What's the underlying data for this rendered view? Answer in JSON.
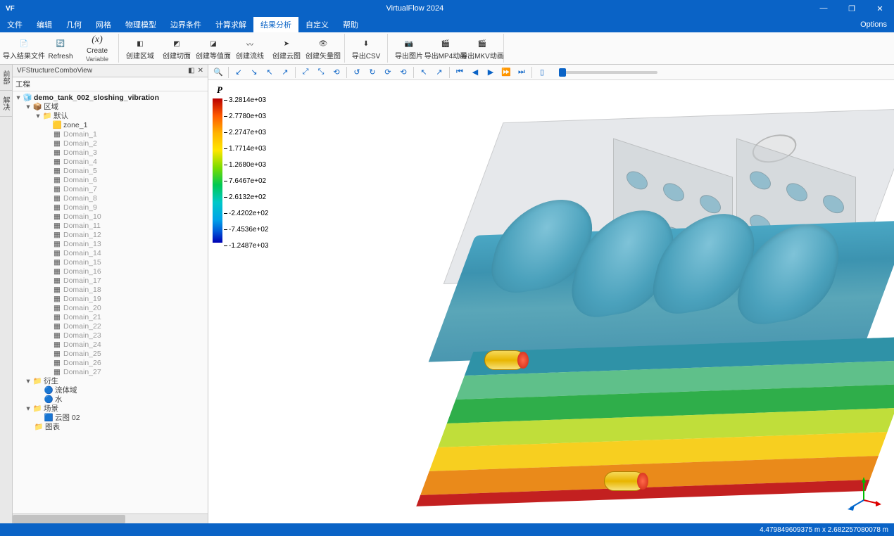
{
  "app": {
    "title": "VirtualFlow  2024",
    "logo": "VF"
  },
  "window_buttons": {
    "min": "—",
    "max": "❐",
    "close": "✕"
  },
  "menu": {
    "items": [
      "文件",
      "编辑",
      "几何",
      "网格",
      "物理模型",
      "边界条件",
      "计算求解",
      "结果分析",
      "自定义",
      "帮助"
    ],
    "active_index": 7,
    "right": "Options"
  },
  "ribbon": [
    {
      "icon": "import-icon",
      "label": "导入结果文件",
      "glyph": "📄"
    },
    {
      "icon": "refresh-icon",
      "label": "Refresh",
      "glyph": "🔄"
    },
    {
      "icon": "variable-icon",
      "label": "Create",
      "label2": "Variable",
      "glyph": "(x)"
    },
    {
      "icon": "region-icon",
      "label": "创建区域",
      "glyph": "◧"
    },
    {
      "icon": "slice-icon",
      "label": "创建切面",
      "glyph": "◩"
    },
    {
      "icon": "iso-icon",
      "label": "创建等值面",
      "glyph": "◪"
    },
    {
      "icon": "streamline-icon",
      "label": "创建流线",
      "glyph": "〰"
    },
    {
      "icon": "contour-icon",
      "label": "创建云图",
      "glyph": "➤"
    },
    {
      "icon": "vector-icon",
      "label": "创建矢量图",
      "glyph": "👁"
    },
    {
      "icon": "csv-icon",
      "label": "导出CSV",
      "glyph": "⬇"
    },
    {
      "icon": "image-icon",
      "label": "导出图片",
      "glyph": "📷"
    },
    {
      "icon": "mp4-icon",
      "label": "导出MP4动画",
      "glyph": "🎬"
    },
    {
      "icon": "mkv-icon",
      "label": "导出MKV动画",
      "glyph": "🎬"
    }
  ],
  "sidebar_tabs": [
    "前部",
    "解决"
  ],
  "tree_panel": {
    "title": "VFStructureComboView",
    "root": "工程",
    "project": "demo_tank_002_sloshing_vibration",
    "region": "区域",
    "default": "默认",
    "zone": "zone_1",
    "domains": [
      "Domain_1",
      "Domain_2",
      "Domain_3",
      "Domain_4",
      "Domain_5",
      "Domain_6",
      "Domain_7",
      "Domain_8",
      "Domain_9",
      "Domain_10",
      "Domain_11",
      "Domain_12",
      "Domain_13",
      "Domain_14",
      "Domain_15",
      "Domain_16",
      "Domain_17",
      "Domain_18",
      "Domain_19",
      "Domain_20",
      "Domain_21",
      "Domain_22",
      "Domain_23",
      "Domain_24",
      "Domain_25",
      "Domain_26",
      "Domain_27"
    ],
    "derived": "衍生",
    "derived_items": [
      "流体域",
      "水"
    ],
    "scene": "场景",
    "scene_items": [
      "云图 02"
    ],
    "chart": "图表"
  },
  "legend": {
    "title": "P",
    "ticks": [
      "3.2814e+03",
      "2.7780e+03",
      "2.2747e+03",
      "1.7714e+03",
      "1.2680e+03",
      "7.6467e+02",
      "2.6132e+02",
      "-2.4202e+02",
      "-7.4536e+02",
      "-1.2487e+03"
    ]
  },
  "playback": {
    "first": "⏮",
    "prev": "◀",
    "play": "▶",
    "next": "⏩",
    "last": "⏭"
  },
  "status": {
    "coords": "4.479849609375 m x 2.682257080078 m"
  },
  "strata_colors": [
    "#2f92a7",
    "#5fc08a",
    "#2fae4a",
    "#c0de3a",
    "#f7cf20",
    "#ea8a1a",
    "#c32020"
  ]
}
